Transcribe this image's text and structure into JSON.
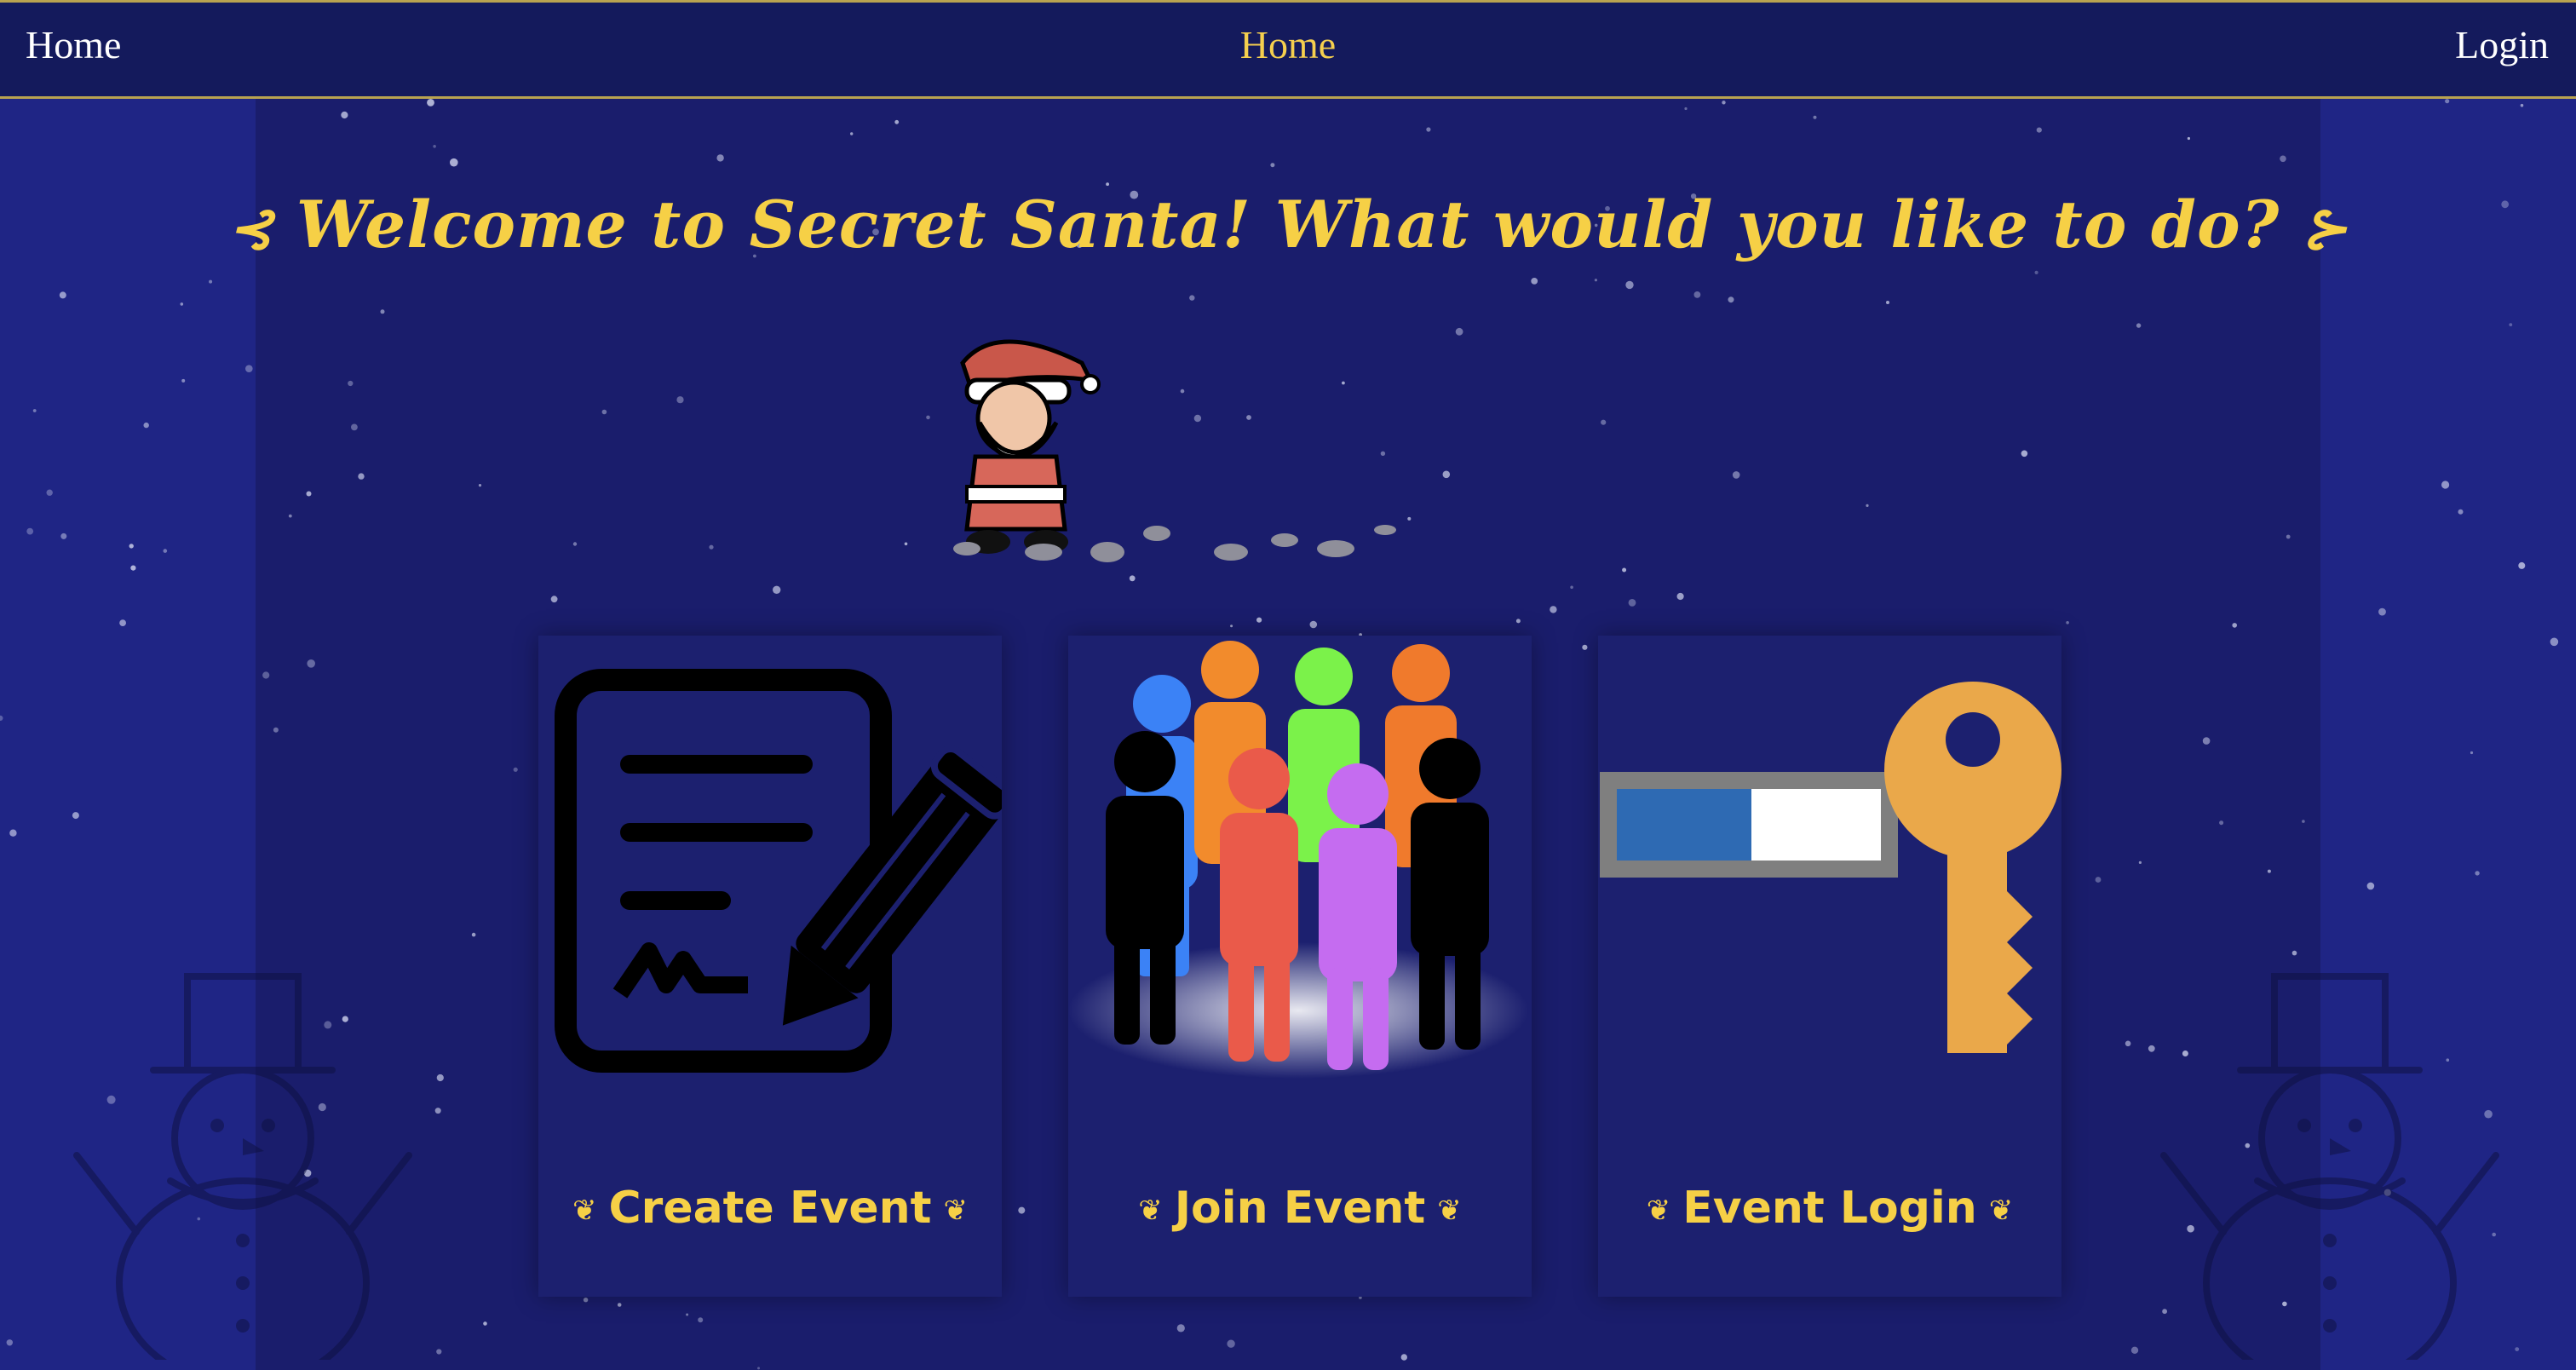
{
  "nav": {
    "home_label": "Home",
    "center_label": "Home",
    "login_label": "Login"
  },
  "main": {
    "title": "Welcome to Secret Santa! What would you like to do?",
    "title_flourish": "⊰",
    "title_flourish_right": "⊱",
    "cards": [
      {
        "label": "Create Event",
        "icon": "contract-pencil-icon"
      },
      {
        "label": "Join Event",
        "icon": "group-people-icon"
      },
      {
        "label": "Event Login",
        "icon": "key-password-icon"
      }
    ],
    "paw": "❦"
  },
  "colors": {
    "accent": "#f6d046",
    "nav_bg": "#141a5c",
    "page_bg": "#1c2078",
    "key": "#eaa84a",
    "progress_fill": "#2e6ab3"
  }
}
